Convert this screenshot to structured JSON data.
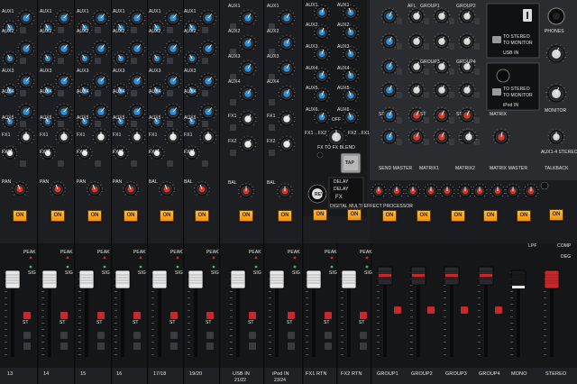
{
  "channel_names": {
    "mono": [
      "13",
      "14",
      "15",
      "16"
    ],
    "stereo": [
      "17/18",
      "19/20"
    ],
    "usb": {
      "line1": "USB IN",
      "line2": "21/22"
    },
    "ipod": {
      "line1": "iPod IN",
      "line2": "23/24"
    },
    "fx_rtn": [
      "FX1 RTN",
      "FX2 RTN"
    ],
    "masters": [
      "GROUP1",
      "GROUP2",
      "GROUP3",
      "GROUP4",
      "MONO",
      "STEREO"
    ]
  },
  "strip_labels": {
    "aux_pairs": [
      [
        "AUX1",
        "AUX2"
      ],
      [
        "AUX3",
        "AUX4"
      ],
      [
        "AUX5",
        "AUX6"
      ]
    ],
    "fx": [
      "FX1",
      "FX2"
    ],
    "pan": "PAN",
    "bal": "BAL",
    "on": "ON",
    "peak": "PEAK",
    "sig": "SIG",
    "st": "ST"
  },
  "fx_section": {
    "left_aux": [
      "AUX1",
      "AUX2",
      "AUX3",
      "AUX4",
      "AUX5",
      "AUX6"
    ],
    "right_aux": [
      "AUX1",
      "AUX2",
      "AUX3",
      "AUX4",
      "AUX5",
      "AUX6"
    ],
    "off": "OFF",
    "fx_to_fx": "FX TO FX BLEND",
    "fx1fx2": "FX1→FX2",
    "fx2fx1": "FX2→FX1",
    "tap": "TAP",
    "delay1": "DELAY",
    "delay2": "DELAY",
    "rev": "REV",
    "fx_logo": "FX",
    "fx_caption": "DIGITAL MULTI EFFECT PROCESSOR"
  },
  "master_section": {
    "send_master": "SEND MASTER",
    "matrix1": "MATRIX1",
    "matrix2": "MATRIX2",
    "matrix_master": "MATRIX MASTER",
    "group_labels": [
      "GROUP1",
      "GROUP2",
      "GROUP3",
      "GROUP4"
    ],
    "afl": "AFL",
    "st": "ST",
    "matrix": "MATRIX",
    "usb_in": "USB IN",
    "usb_to_stereo": "TO STEREO",
    "usb_to_monitor": "TO MONITOR",
    "ipod_in": "iPod IN",
    "ipod_to_stereo": "TO STEREO",
    "ipod_to_monitor": "TO MONITOR",
    "phones": "PHONES",
    "monitor": "MONITOR",
    "talkback": "TALKBACK",
    "aux4_stereo": "AUX1-4 STEREO"
  },
  "fader_labels": {
    "lpf": "LPF",
    "comp": "COMP",
    "deg": "DEG"
  },
  "colors": {
    "panel": "#1b1c1f",
    "aux_knob": "#2f8fd6",
    "fx_knob": "#e8e8e8",
    "pan_knob": "#d83a2a",
    "on_button": "#f7a91f",
    "fader_cap_white": "#e8e8e8",
    "fader_cap_red": "#c8282b"
  }
}
